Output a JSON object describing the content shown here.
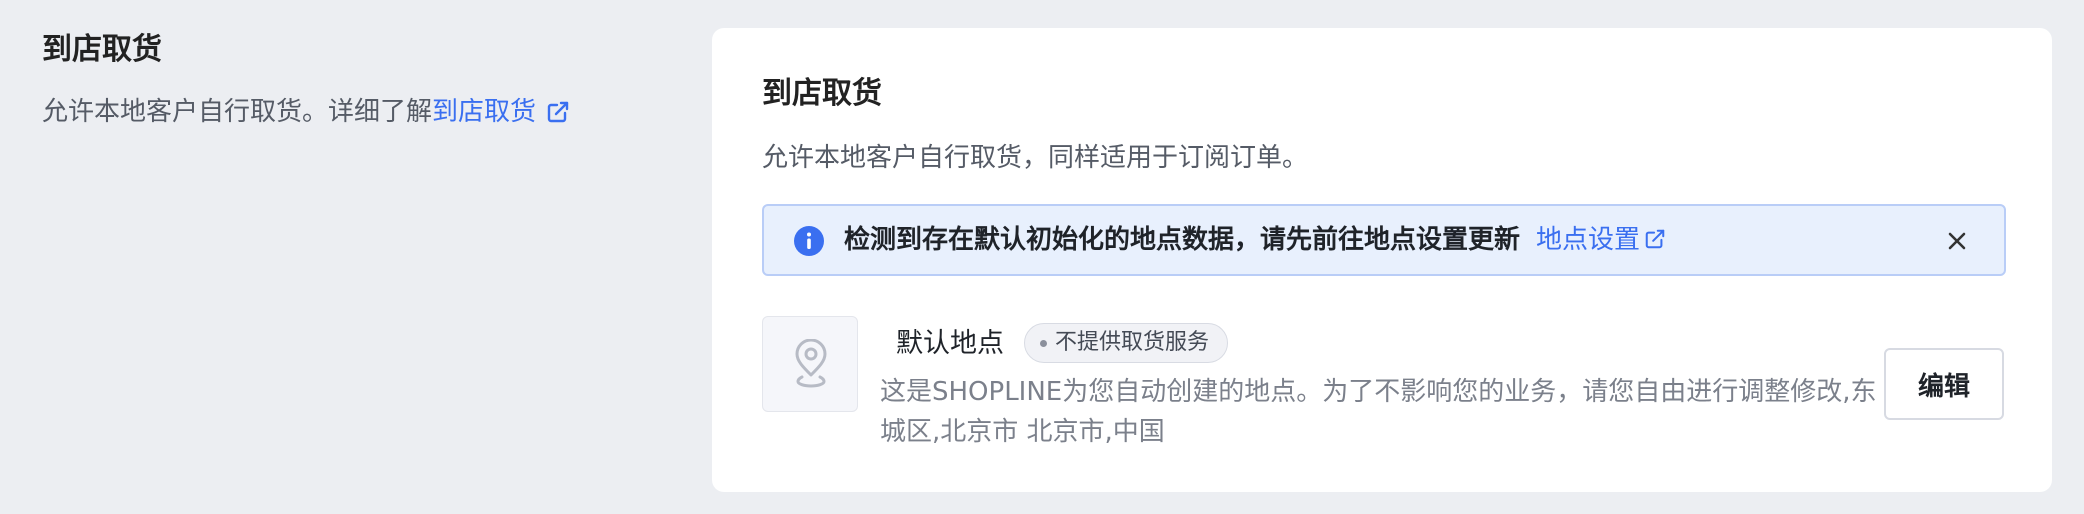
{
  "section": {
    "title": "到店取货",
    "description": "允许本地客户自行取货。详细了解",
    "learn_more_link": "到店取货"
  },
  "card": {
    "title": "到店取货",
    "description": "允许本地客户自行取货，同样适用于订阅订单。",
    "alert": {
      "message": "检测到存在默认初始化的地点数据，请先前往地点设置更新",
      "link": "地点设置"
    },
    "location": {
      "name": "默认地点",
      "status": "不提供取货服务",
      "description": "这是SHOPLINE为您自动创建的地点。为了不影响您的业务，请您自由进行调整修改,东城区,北京市 北京市,中国",
      "edit_label": "编辑"
    }
  },
  "colors": {
    "background": "#eceef2",
    "card": "#ffffff",
    "link": "#3a6ff0",
    "alert_bg": "#e8f0fd",
    "alert_border": "#b9cdf7",
    "info_icon": "#3a6ff0"
  },
  "icons": {
    "external_link": "external-link-icon",
    "info": "info-icon",
    "close": "close-icon",
    "location": "location-pin-icon"
  }
}
